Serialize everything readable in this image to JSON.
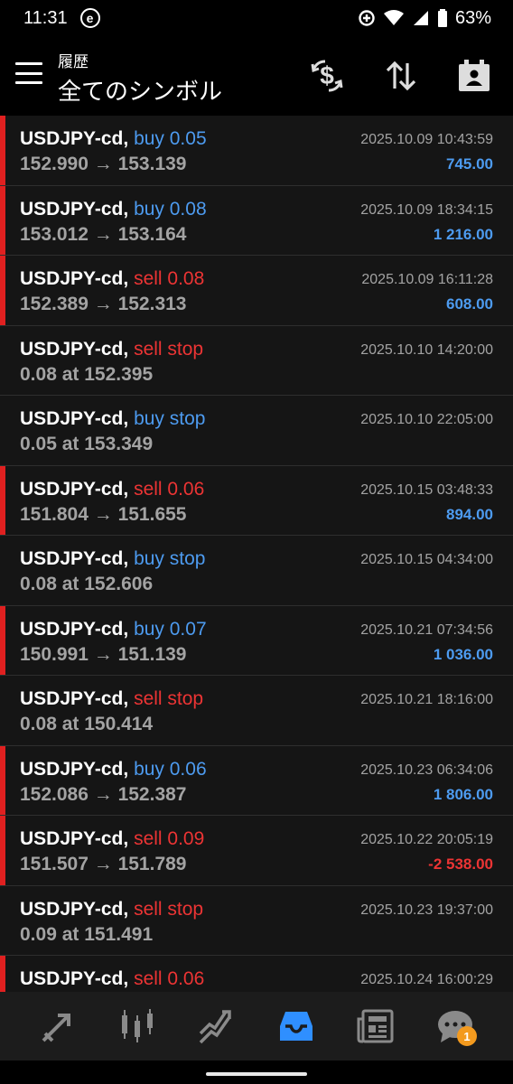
{
  "status": {
    "time": "11:31",
    "battery": "63%"
  },
  "header": {
    "subtitle": "履歴",
    "title": "全てのシンボル"
  },
  "rows": [
    {
      "symbol": "USDJPY-cd,",
      "type": "buy 0.05",
      "side": "buy",
      "price": "152.990 → 153.139",
      "time": "2025.10.09 10:43:59",
      "profit": "745.00",
      "bar": true
    },
    {
      "symbol": "USDJPY-cd,",
      "type": "buy 0.08",
      "side": "buy",
      "price": "153.012 → 153.164",
      "time": "2025.10.09 18:34:15",
      "profit": "1 216.00",
      "bar": true
    },
    {
      "symbol": "USDJPY-cd,",
      "type": "sell 0.08",
      "side": "sell",
      "price": "152.389 → 152.313",
      "time": "2025.10.09 16:11:28",
      "profit": "608.00",
      "bar": true
    },
    {
      "symbol": "USDJPY-cd,",
      "type": "sell stop",
      "side": "sell",
      "price": "0.08 at 152.395",
      "time": "2025.10.10 14:20:00",
      "profit": "",
      "bar": false
    },
    {
      "symbol": "USDJPY-cd,",
      "type": "buy stop",
      "side": "buy",
      "price": "0.05 at 153.349",
      "time": "2025.10.10 22:05:00",
      "profit": "",
      "bar": false
    },
    {
      "symbol": "USDJPY-cd,",
      "type": "sell 0.06",
      "side": "sell",
      "price": "151.804 → 151.655",
      "time": "2025.10.15 03:48:33",
      "profit": "894.00",
      "bar": true
    },
    {
      "symbol": "USDJPY-cd,",
      "type": "buy stop",
      "side": "buy",
      "price": "0.08 at 152.606",
      "time": "2025.10.15 04:34:00",
      "profit": "",
      "bar": false
    },
    {
      "symbol": "USDJPY-cd,",
      "type": "buy 0.07",
      "side": "buy",
      "price": "150.991 → 151.139",
      "time": "2025.10.21 07:34:56",
      "profit": "1 036.00",
      "bar": true
    },
    {
      "symbol": "USDJPY-cd,",
      "type": "sell stop",
      "side": "sell",
      "price": "0.08 at 150.414",
      "time": "2025.10.21 18:16:00",
      "profit": "",
      "bar": false
    },
    {
      "symbol": "USDJPY-cd,",
      "type": "buy 0.06",
      "side": "buy",
      "price": "152.086 → 152.387",
      "time": "2025.10.23 06:34:06",
      "profit": "1 806.00",
      "bar": true
    },
    {
      "symbol": "USDJPY-cd,",
      "type": "sell 0.09",
      "side": "sell",
      "price": "151.507 → 151.789",
      "time": "2025.10.22 20:05:19",
      "profit": "-2 538.00",
      "bar": true
    },
    {
      "symbol": "USDJPY-cd,",
      "type": "sell stop",
      "side": "sell",
      "price": "0.09 at 151.491",
      "time": "2025.10.23 19:37:00",
      "profit": "",
      "bar": false
    },
    {
      "symbol": "USDJPY-cd,",
      "type": "sell 0.06",
      "side": "sell",
      "price": "",
      "time": "2025.10.24 16:00:29",
      "profit": "",
      "bar": true
    }
  ],
  "nav": {
    "items": [
      "quotes-icon",
      "chart-icon",
      "trade-icon",
      "history-icon",
      "news-icon",
      "messages-icon"
    ],
    "active": "history-icon",
    "messages_badge": "1"
  },
  "colors": {
    "buy": "#4d9bf0",
    "sell": "#ec3434",
    "accent": "#2f8fff",
    "badge": "#f39a1e"
  }
}
